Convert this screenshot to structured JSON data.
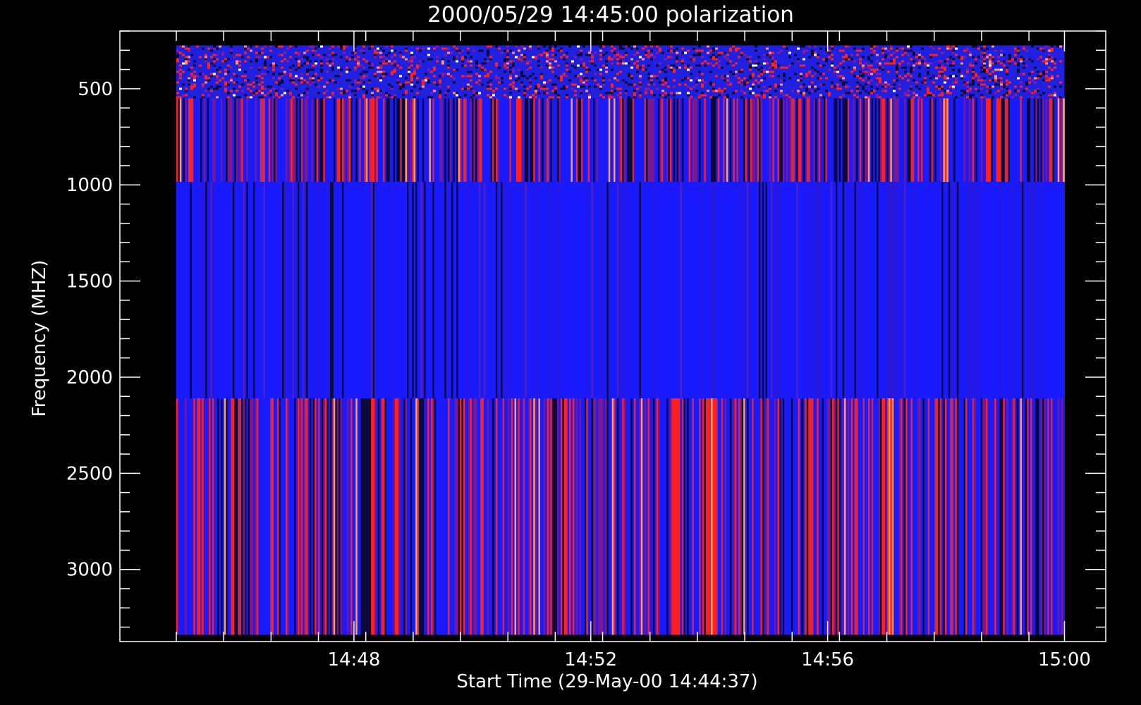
{
  "chart_data": {
    "type": "heatmap",
    "title": "2000/05/29 14:45:00 polarization",
    "xlabel": "Start Time (29-May-00 14:44:37)",
    "ylabel": "Frequency (MHZ)",
    "x_axis": {
      "unit": "minutes since 14:44:37",
      "range": [
        -0.57,
        16.08
      ],
      "major_ticks": [
        {
          "label": "14:48",
          "value": 3.383
        },
        {
          "label": "14:52",
          "value": 7.383
        },
        {
          "label": "14:56",
          "value": 11.383
        },
        {
          "label": "15:00",
          "value": 15.383
        }
      ],
      "minor_tick_step": 0.8
    },
    "y_axis": {
      "range": [
        200,
        3375
      ],
      "inverted": true,
      "major_ticks": [
        500,
        1000,
        1500,
        2000,
        2500,
        3000
      ],
      "minor_tick_step": 100
    },
    "image_extent": {
      "time_start": 0.383,
      "time_end": 15.383,
      "freq_start": 275,
      "freq_end": 3340
    },
    "bands": [
      {
        "name": "band-1",
        "freq_start": 275,
        "freq_end": 550,
        "pattern": "speckle",
        "base_color": "#2020e0"
      },
      {
        "name": "band-2",
        "freq_start": 550,
        "freq_end": 985,
        "pattern": "stripes",
        "base_color": "#3018b8"
      },
      {
        "name": "band-3",
        "freq_start": 985,
        "freq_end": 2110,
        "pattern": "stripes-calm",
        "base_color": "#1010f0"
      },
      {
        "name": "band-4",
        "freq_start": 2110,
        "freq_end": 3340,
        "pattern": "stripes",
        "base_color": "#2020d0"
      }
    ],
    "colors": {
      "background": "#000000",
      "axes": "#ffffff",
      "low": "#0a0a3a",
      "mid": "#1a1aff",
      "high": "#ff2020",
      "peak": "#ffa060"
    }
  }
}
